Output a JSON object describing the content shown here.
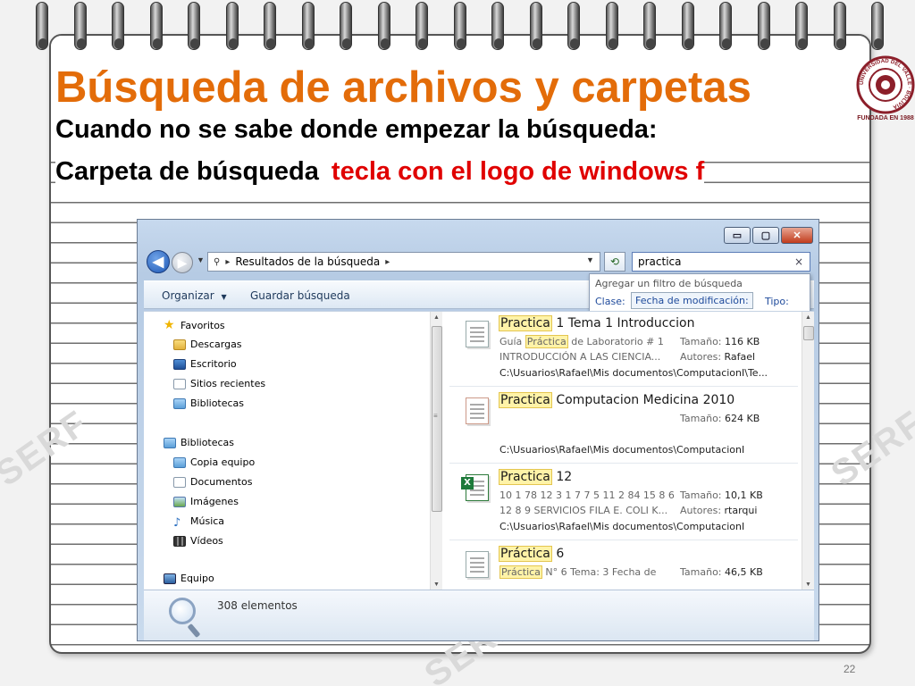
{
  "slide": {
    "title": "Búsqueda de archivos y carpetas",
    "line1": "Cuando no se sabe donde empezar la búsqueda:",
    "line2_prefix": "Carpeta de búsqueda",
    "line2_highlight": "tecla con el logo de windows  f",
    "page_number": "22",
    "accent_color": "#e36c09",
    "highlight_color": "#e00000",
    "logo": {
      "ring_text": "UNIVERSIDAD DEL VALLE · BOLIVIA",
      "caption": "FUNDADA EN 1988"
    }
  },
  "window": {
    "caption_buttons": {
      "minimize": "▭",
      "maximize": "▢",
      "close": "✕"
    },
    "nav": {
      "back_icon": "◀",
      "forward_icon": "▶",
      "history_dropdown": "▼",
      "address_search_icon": "⚲",
      "address_sep": "▸",
      "address_path": "Resultados de la búsqueda",
      "address_sep2": "▸",
      "address_dropdown": "▼",
      "refresh_icon": "⟲",
      "search_value": "practica",
      "search_clear": "×"
    },
    "toolbar": {
      "organize": "Organizar",
      "organize_caret": "▼",
      "save_search": "Guardar búsqueda"
    },
    "filter_popup": {
      "header": "Agregar un filtro de búsqueda",
      "clase": "Clase:",
      "fecha": "Fecha de modificación:",
      "tipo": "Tipo:"
    },
    "nav_pane": {
      "favorites": "Favoritos",
      "downloads": "Descargas",
      "desktop": "Escritorio",
      "recent": "Sitios recientes",
      "libraries_fav": "Bibliotecas",
      "libraries": "Bibliotecas",
      "copy": "Copia equipo",
      "documents": "Documentos",
      "pictures": "Imágenes",
      "music": "Música",
      "videos": "Vídeos",
      "computer": "Equipo"
    },
    "results": [
      {
        "title_hl": "Practica",
        "title_rest": " 1 Tema 1 Introduccion",
        "sub1_pre": "Guía ",
        "sub1_hl": "Práctica",
        "sub1_post": " de Laboratorio # 1",
        "sub2": "INTRODUCCIÓN A LAS CIENCIA...",
        "meta1_label": "Tamaño: ",
        "meta1_value": "116 KB",
        "meta2_label": "Autores: ",
        "meta2_value": "Rafael",
        "path": "C:\\Usuarios\\Rafael\\Mis documentos\\ComputacionI\\Te..."
      },
      {
        "title_hl": "Practica",
        "title_rest": " Computacion Medicina 2010",
        "meta1_label": "Tamaño: ",
        "meta1_value": "624 KB",
        "path": "C:\\Usuarios\\Rafael\\Mis documentos\\ComputacionI"
      },
      {
        "title_hl": "Practica",
        "title_rest": " 12",
        "sub1": "10 1 78 12 3 1 7 7 5 11 2 84 15 8 6",
        "sub2": "12 8 9 SERVICIOS FILA E. COLI K...",
        "meta1_label": "Tamaño: ",
        "meta1_value": "10,1 KB",
        "meta2_label": "Autores: ",
        "meta2_value": "rtarqui",
        "path": "C:\\Usuarios\\Rafael\\Mis documentos\\ComputacionI"
      },
      {
        "title_hl": "Práctica",
        "title_rest": " 6",
        "sub1_hl": "Práctica",
        "sub1_post": " N° 6 Tema: 3 Fecha de",
        "meta1_label": "Tamaño: ",
        "meta1_value": "46,5 KB"
      }
    ],
    "status": "308 elementos"
  }
}
